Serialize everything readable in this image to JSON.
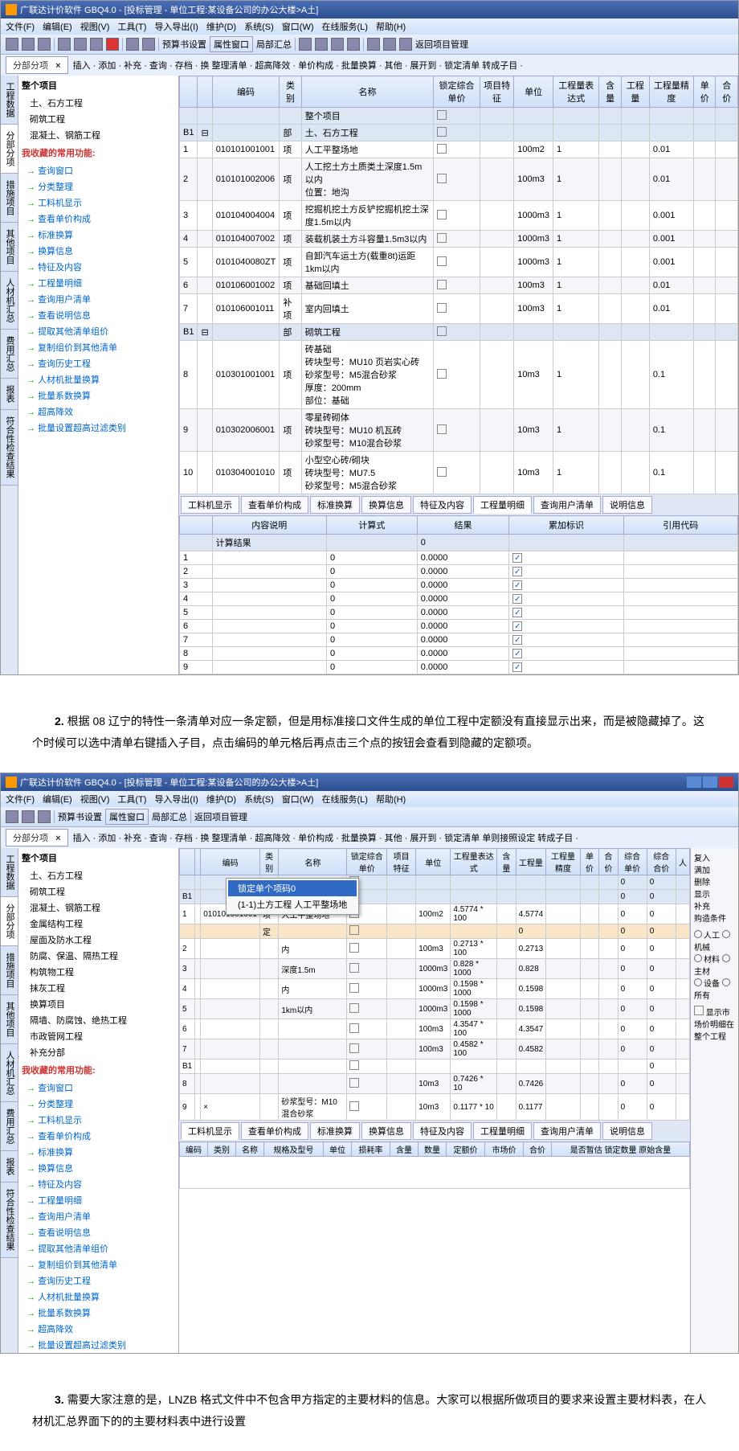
{
  "app1": {
    "title": "广联达计价软件 GBQ4.0 - [投标管理 - 单位工程:某设备公司的办公大楼>A土]",
    "menus": [
      "文件(F)",
      "编辑(E)",
      "视图(V)",
      "工具(T)",
      "导入导出(I)",
      "维护(D)",
      "系统(S)",
      "窗口(W)",
      "在线服务(L)",
      "帮助(H)"
    ],
    "toolbarText": [
      "预算书设置",
      "属性窗口",
      "局部汇总",
      "返回项目管理"
    ],
    "tabLabel": "分部分项",
    "subbar": "插入 · 添加 · 补充 · 查询 · 存档 · 换 整理清单 · 超高降效 · 单价构成 · 批量换算 · 其他 · 展开到 · 锁定清单 转成子目 ·",
    "treeTop": {
      "root": "整个项目",
      "items": [
        "土、石方工程",
        "砌筑工程",
        "混凝土、钢筋工程"
      ]
    },
    "treeSections": {
      "fav": "我收藏的常用功能:",
      "favItems": [
        "查询窗口",
        "分类整理",
        "工料机显示",
        "查看单价构成",
        "标准换算",
        "换算信息",
        "特征及内容",
        "工程量明细",
        "查询用户清单",
        "查看说明信息",
        "提取其他清单组价",
        "复制组价到其他清单",
        "查询历史工程",
        "人材机批量换算",
        "批量系数换算",
        "超高降效",
        "批量设置超高过滤类别"
      ]
    },
    "sideTabs": [
      "工程数据",
      "分部分项",
      "措施项目",
      "其他项目",
      "人材机汇总",
      "费用汇总",
      "报表",
      "符合性检查结果"
    ],
    "gridHeaders": [
      "",
      "",
      "编码",
      "类别",
      "名称",
      "锁定综合单价",
      "项目特征",
      "单位",
      "工程量表达式",
      "含量",
      "工程量",
      "工程量精度",
      "单价",
      "合价"
    ],
    "rows": [
      {
        "no": "",
        "code": "",
        "type": "",
        "name": "整个项目",
        "unit": "",
        "expr": "",
        "prec": ""
      },
      {
        "no": "B1",
        "code": "",
        "type": "部",
        "name": "土、石方工程",
        "unit": "",
        "expr": "",
        "prec": ""
      },
      {
        "no": "1",
        "code": "010101001001",
        "type": "项",
        "name": "人工平整场地",
        "unit": "100m2",
        "expr": "1",
        "prec": "0.01"
      },
      {
        "no": "2",
        "code": "010101002006",
        "type": "项",
        "name": "人工挖土方土质类土深度1.5m以内\\n位置：地沟",
        "unit": "100m3",
        "expr": "1",
        "prec": "0.01"
      },
      {
        "no": "3",
        "code": "010104004004",
        "type": "项",
        "name": "挖掘机挖土方反铲挖掘机挖土深度1.5m以内",
        "unit": "1000m3",
        "expr": "1",
        "prec": "0.001"
      },
      {
        "no": "4",
        "code": "010104007002",
        "type": "项",
        "name": "装载机装土方斗容量1.5m3以内",
        "unit": "1000m3",
        "expr": "1",
        "prec": "0.001"
      },
      {
        "no": "5",
        "code": "0101040080ZT",
        "type": "项",
        "name": "自卸汽车运土方(载重8t)运距1km以内",
        "unit": "1000m3",
        "expr": "1",
        "prec": "0.001"
      },
      {
        "no": "6",
        "code": "010106001002",
        "type": "项",
        "name": "基础回填土",
        "unit": "100m3",
        "expr": "1",
        "prec": "0.01"
      },
      {
        "no": "7",
        "code": "010106001011",
        "type": "补项",
        "name": "室内回填土",
        "unit": "100m3",
        "expr": "1",
        "prec": "0.01"
      },
      {
        "no": "B1",
        "code": "",
        "type": "部",
        "name": "砌筑工程",
        "unit": "",
        "expr": "",
        "prec": ""
      },
      {
        "no": "8",
        "code": "010301001001",
        "type": "项",
        "name": "砖基础\\n砖块型号：MU10 页岩实心砖\\n砂浆型号：M5混合砂浆\\n厚度：200mm\\n部位：基础",
        "unit": "10m3",
        "expr": "1",
        "prec": "0.1"
      },
      {
        "no": "9",
        "code": "010302006001",
        "type": "项",
        "name": "零星砖砌体\\n砖块型号：MU10 机瓦砖\\n砂浆型号：M10混合砂浆",
        "unit": "10m3",
        "expr": "1",
        "prec": "0.1"
      },
      {
        "no": "10",
        "code": "010304001010",
        "type": "项",
        "name": "小型空心砖/砌块\\n砖块型号：MU7.5\\n砂浆型号：M5混合砂浆",
        "unit": "10m3",
        "expr": "1",
        "prec": "0.1"
      }
    ],
    "bottomTabs": [
      "工料机显示",
      "查看单价构成",
      "标准换算",
      "换算信息",
      "特征及内容",
      "工程量明细",
      "查询用户清单",
      "说明信息"
    ],
    "calcHeaders": [
      "",
      "内容说明",
      "计算式",
      "结果",
      "累加标识",
      "引用代码"
    ],
    "calcSubrow": "计算结果",
    "calcRows": [
      {
        "n": "1",
        "v": "0",
        "r": "0.0000"
      },
      {
        "n": "2",
        "v": "0",
        "r": "0.0000"
      },
      {
        "n": "3",
        "v": "0",
        "r": "0.0000"
      },
      {
        "n": "4",
        "v": "0",
        "r": "0.0000"
      },
      {
        "n": "5",
        "v": "0",
        "r": "0.0000"
      },
      {
        "n": "6",
        "v": "0",
        "r": "0.0000"
      },
      {
        "n": "7",
        "v": "0",
        "r": "0.0000"
      },
      {
        "n": "8",
        "v": "0",
        "r": "0.0000"
      },
      {
        "n": "9",
        "v": "0",
        "r": "0.0000"
      }
    ],
    "calcZero": "0"
  },
  "para2_num": "2.",
  "para2": "根据 08 辽宁的特性一条清单对应一条定额，但是用标准接口文件生成的单位工程中定额没有直接显示出来，而是被隐藏掉了。这个时候可以选中清单右键插入子目，点击编码的单元格后再点击三个点的按钮会查看到隐藏的定额项。",
  "app2": {
    "title": "广联达计价软件 GBQ4.0 - [投标管理 - 单位工程:某设备公司的办公大楼>A土]",
    "menus": [
      "文件(F)",
      "编辑(E)",
      "视图(V)",
      "工具(T)",
      "导入导出(I)",
      "维护(D)",
      "系统(S)",
      "窗口(W)",
      "在线服务(L)",
      "帮助(H)"
    ],
    "toolbarText": [
      "预算书设置",
      "属性窗口",
      "局部汇总",
      "返回项目管理"
    ],
    "subbar": "插入 · 添加 · 补充 · 查询 · 存档 · 换 整理清单 · 超高降效 · 单价构成 · 批量换算 · 其他 · 展开到 · 锁定清单 单则接照设定 转成子目 ·",
    "tabLabel": "分部分项",
    "treeTop": {
      "root": "整个项目",
      "items": [
        "土、石方工程",
        "砌筑工程",
        "混凝土、钢筋工程",
        "金属结构工程",
        "屋面及防水工程",
        "防腐、保温、隔热工程",
        "构筑物工程",
        "抹灰工程",
        "换算项目",
        "隔墙、防腐蚀、绝热工程",
        "市政管网工程",
        "补充分部"
      ]
    },
    "gridHeaders": [
      "",
      "",
      "编码",
      "类别",
      "名称",
      "锁定综合单价",
      "项目特征",
      "单位",
      "工程量表达式",
      "含量",
      "工程量",
      "工程量精度",
      "单价",
      "合价",
      "综合单价",
      "综合合价",
      "人"
    ],
    "contextMenu": [
      "锁定单个项码0",
      "(1-1)土方工程 人工平整场地"
    ],
    "rows": [
      {
        "no": "",
        "type": "",
        "name": "整个项目",
        "unit": "",
        "expr": "",
        "qty": "",
        "p": "0",
        "hp": "0"
      },
      {
        "no": "B1",
        "type": "部",
        "name": "土、石方工程",
        "unit": "",
        "expr": "",
        "qty": "",
        "p": "0",
        "hp": "0"
      },
      {
        "no": "1",
        "code": "010101001001",
        "type": "项",
        "name": "人工平整场地",
        "unit": "100m2",
        "expr": "4.5774 * 100",
        "qty": "4.5774",
        "p": "0",
        "hp": "0"
      },
      {
        "no": "",
        "type": "定",
        "name": "",
        "unit": "",
        "expr": "",
        "qty": "0",
        "p": "0",
        "hp": "0",
        "sub": true
      },
      {
        "no": "2",
        "type": "",
        "name": "内",
        "unit": "100m3",
        "expr": "0.2713 * 100",
        "qty": "0.2713",
        "p": "0",
        "hp": "0"
      },
      {
        "no": "3",
        "type": "",
        "name": "深度1.5m",
        "unit": "1000m3",
        "expr": "0.828 * 1000",
        "qty": "0.828",
        "p": "0",
        "hp": "0"
      },
      {
        "no": "4",
        "type": "",
        "name": "内",
        "unit": "1000m3",
        "expr": "0.1598 * 1000",
        "qty": "0.1598",
        "p": "0",
        "hp": "0"
      },
      {
        "no": "5",
        "type": "",
        "name": "1km以内",
        "unit": "1000m3",
        "expr": "0.1598 * 1000",
        "qty": "0.1598",
        "p": "0",
        "hp": "0"
      },
      {
        "no": "6",
        "type": "",
        "name": "",
        "unit": "100m3",
        "expr": "4.3547 * 100",
        "qty": "4.3547",
        "p": "0",
        "hp": "0"
      },
      {
        "no": "7",
        "type": "",
        "name": "",
        "unit": "100m3",
        "expr": "0.4582 * 100",
        "qty": "0.4582",
        "p": "0",
        "hp": "0"
      },
      {
        "no": "B1",
        "type": "",
        "name": "",
        "unit": "",
        "expr": "",
        "qty": "",
        "p": "",
        "hp": "0"
      },
      {
        "no": "8",
        "type": "",
        "name": "",
        "unit": "10m3",
        "expr": "0.7426 * 10",
        "qty": "0.7426",
        "p": "0",
        "hp": "0"
      },
      {
        "no": "9",
        "code": "×",
        "type": "",
        "name": "砂浆型号：M10混合砂浆",
        "unit": "10m3",
        "expr": "0.1177 * 10",
        "qty": "0.1177",
        "p": "0",
        "hp": "0"
      }
    ],
    "bottomTabs": [
      "工料机显示",
      "查看单价构成",
      "标准换算",
      "换算信息",
      "特征及内容",
      "工程量明细",
      "查询用户清单",
      "说明信息"
    ],
    "subHeaders": [
      "编码",
      "类别",
      "名称",
      "规格及型号",
      "单位",
      "损耗率",
      "含量",
      "数量",
      "定额价",
      "市场价",
      "合价",
      "是否暂估 锁定数量 原始含量"
    ],
    "rightPanel": {
      "buttons": [
        "复入",
        "满加",
        "删除",
        "显示",
        "补充",
        "购造条件"
      ],
      "radios": [
        "人工",
        "机械",
        "材料",
        "主材",
        "设备",
        "所有"
      ],
      "checkbox": "显示市场价明细在整个工程"
    }
  },
  "para3_num": "3.",
  "para3": "需要大家注意的是，LNZB 格式文件中不包含甲方指定的主要材料的信息。大家可以根据所做项目的要求来设置主要材料表，在人材机汇总界面下的的主要材料表中进行设置"
}
